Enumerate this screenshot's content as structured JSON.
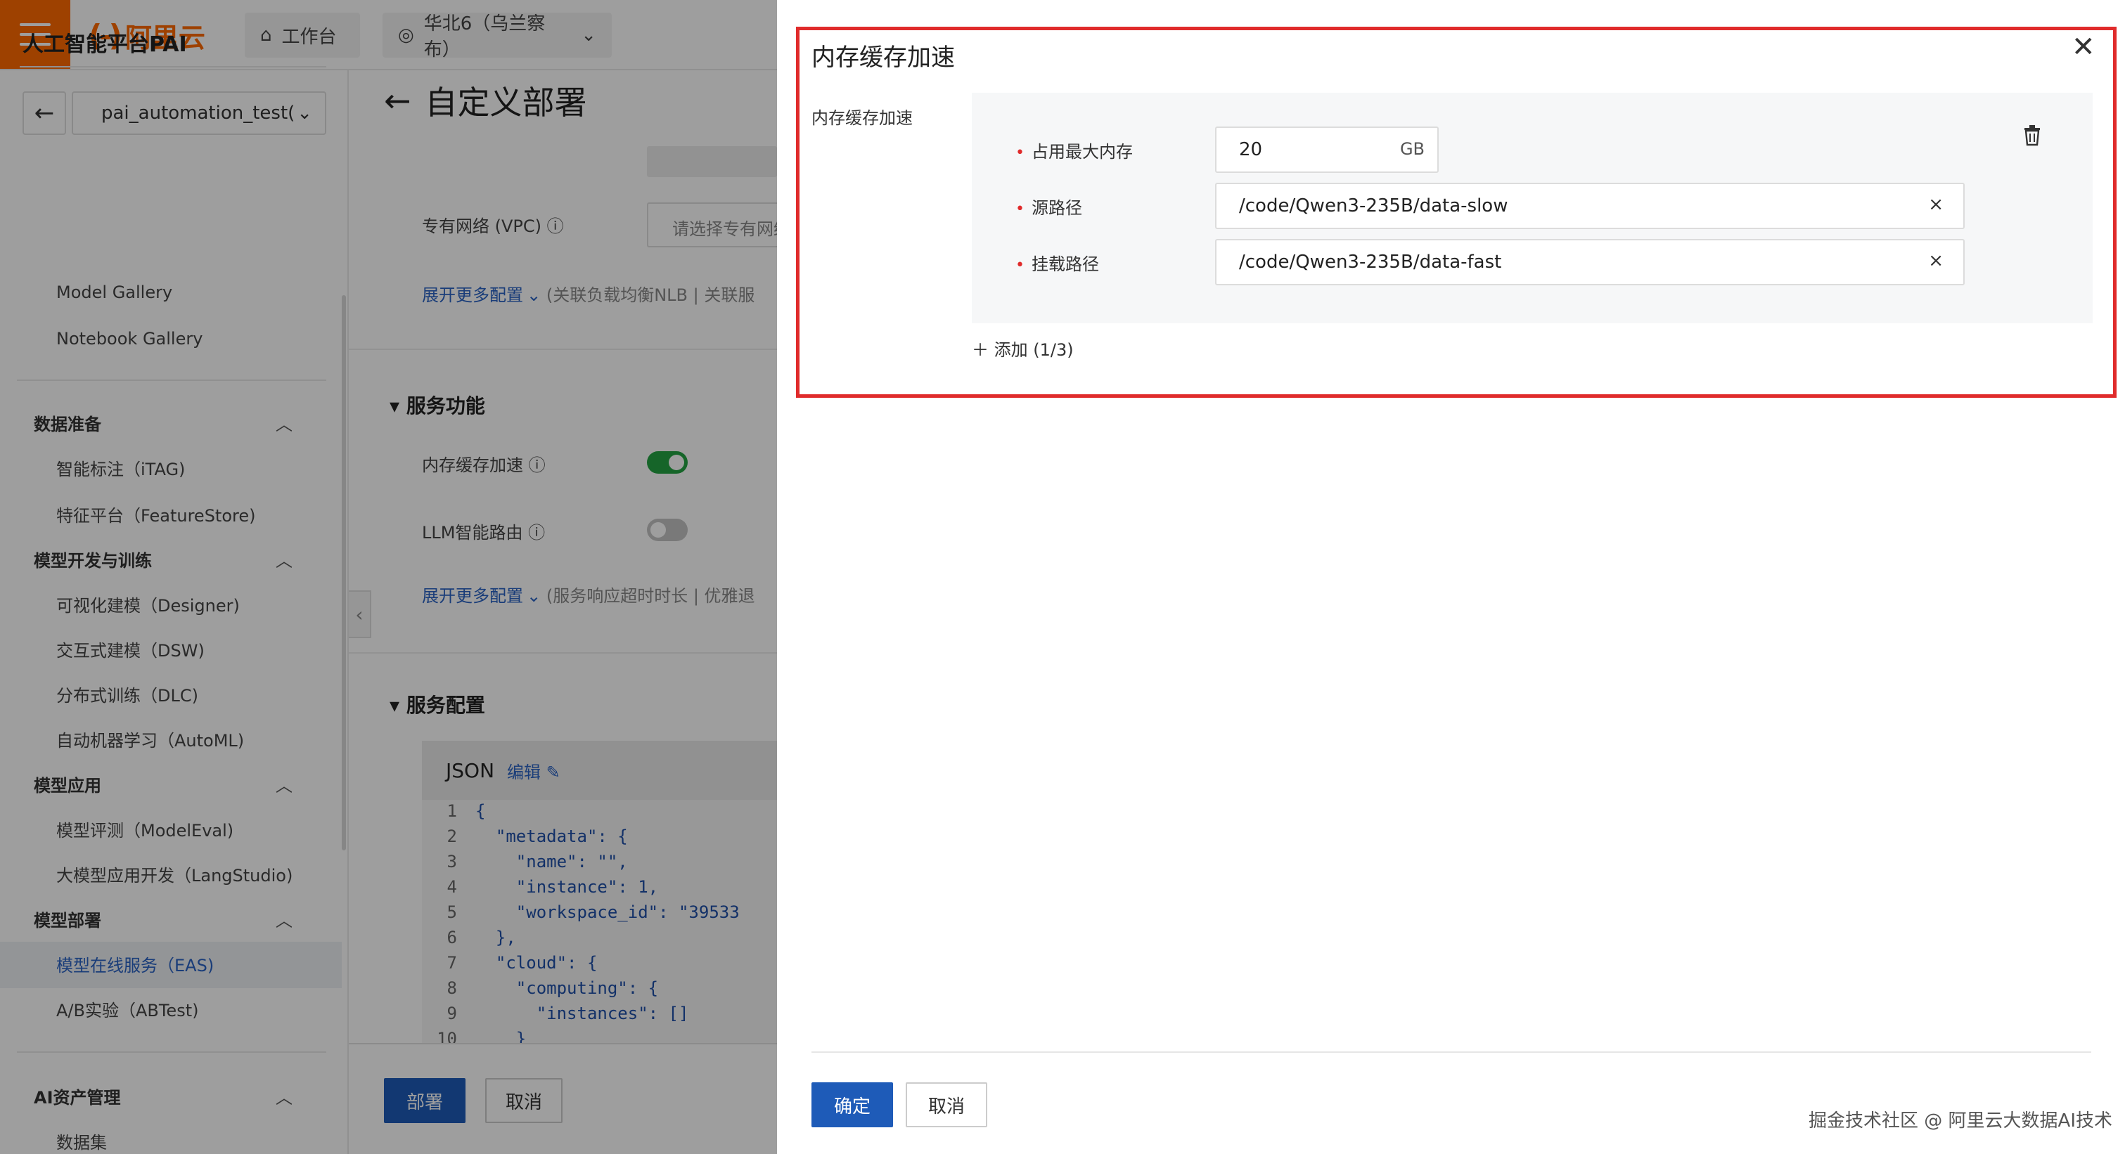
{
  "topbar": {
    "logo_text": "阿里云",
    "workbench_label": "工作台",
    "region_label": "华北6（乌兰察布）"
  },
  "sidebar": {
    "title": "人工智能平台PAI",
    "workspace": "pai_automation_test(",
    "items": [
      {
        "label": "Model Gallery"
      },
      {
        "label": "Notebook Gallery"
      }
    ],
    "groups": [
      {
        "label": "数据准备",
        "items": [
          "智能标注（iTAG)",
          "特征平台（FeatureStore)"
        ]
      },
      {
        "label": "模型开发与训练",
        "items": [
          "可视化建模（Designer)",
          "交互式建模（DSW)",
          "分布式训练（DLC)",
          "自动机器学习（AutoML)"
        ]
      },
      {
        "label": "模型应用",
        "items": [
          "模型评测（ModelEval)",
          "大模型应用开发（LangStudio)"
        ]
      },
      {
        "label": "模型部署",
        "items": [
          "模型在线服务（EAS)",
          "A/B实验（ABTest)"
        ]
      },
      {
        "label": "AI资产管理",
        "items": [
          "数据集"
        ]
      }
    ]
  },
  "main": {
    "page_title": "自定义部署",
    "vpc_label": "专有网络 (VPC)",
    "vpc_placeholder": "请选择专有网络",
    "expand_more_1": "展开更多配置",
    "expand_more_1_hint": "(关联负载均衡NLB  |  关联服",
    "section_service_features": "服务功能",
    "memory_cache_label": "内存缓存加速",
    "llm_router_label": "LLM智能路由",
    "expand_more_2": "展开更多配置",
    "expand_more_2_hint": "(服务响应超时时长  |  优雅退",
    "section_service_config": "服务配置",
    "json_label": "JSON",
    "json_edit": "编辑",
    "code_lines": [
      "{",
      "  \"metadata\": {",
      "    \"name\": \"\",",
      "    \"instance\": 1,",
      "    \"workspace_id\": \"39533",
      "  },",
      "  \"cloud\": {",
      "    \"computing\": {",
      "      \"instances\": []",
      "    }"
    ],
    "line_numbers": [
      "1",
      "2",
      "3",
      "4",
      "5",
      "6",
      "7",
      "8",
      "9",
      "10"
    ],
    "deploy_button": "部署",
    "cancel_button": "取消"
  },
  "drawer": {
    "title": "内存缓存加速",
    "field_label": "内存缓存加速",
    "max_memory_label": "占用最大内存",
    "max_memory_value": "20",
    "max_memory_unit": "GB",
    "source_path_label": "源路径",
    "source_path_value": "/code/Qwen3-235B/data-slow",
    "mount_path_label": "挂载路径",
    "mount_path_value": "/code/Qwen3-235B/data-fast",
    "add_label": "添加 (1/3)",
    "ok_button": "确定",
    "cancel_button": "取消"
  },
  "watermark": "掘金技术社区 @ 阿里云大数据AI技术",
  "colors": {
    "brand_orange": "#ff6a00",
    "primary_blue": "#1e5bb8",
    "toggle_on": "#25a443",
    "highlight_red": "#e02b2b"
  },
  "icons": [
    "hamburger-menu-icon",
    "home-icon",
    "location-icon",
    "chevron-down-icon",
    "back-arrow-icon",
    "chevron-up-icon",
    "help-icon",
    "edit-icon",
    "close-icon",
    "trash-icon",
    "plus-icon",
    "clear-icon"
  ]
}
